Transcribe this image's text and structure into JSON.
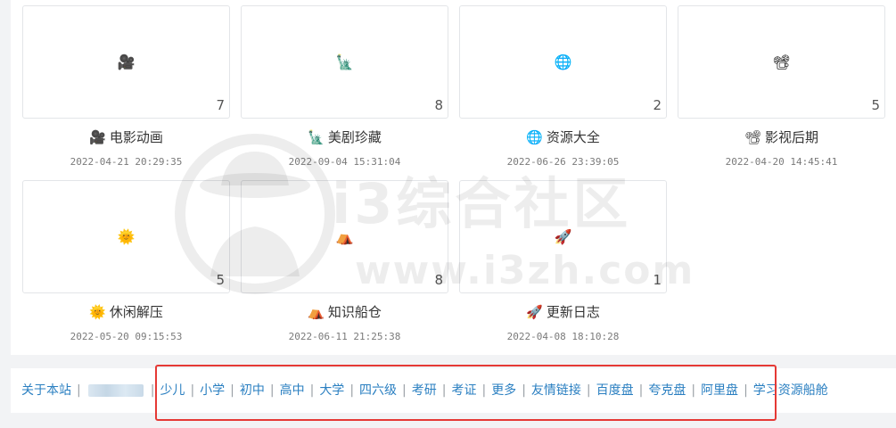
{
  "categories": [
    {
      "emoji": "🎥",
      "icon": "movie-camera-icon",
      "title": "电影动画",
      "count": "7",
      "date": "2022-04-21 20:29:35"
    },
    {
      "emoji": "🗽",
      "icon": "statue-of-liberty-icon",
      "title": "美剧珍藏",
      "count": "8",
      "date": "2022-09-04 15:31:04"
    },
    {
      "emoji": "🌐",
      "icon": "globe-icon",
      "title": "资源大全",
      "count": "2",
      "date": "2022-06-26 23:39:05"
    },
    {
      "emoji": "📽",
      "icon": "film-projector-icon",
      "title": "影视后期",
      "count": "5",
      "date": "2022-04-20 14:45:41"
    },
    {
      "emoji": "🌞",
      "icon": "sun-face-icon",
      "title": "休闲解压",
      "count": "5",
      "date": "2022-05-20 09:15:53"
    },
    {
      "emoji": "⛺",
      "icon": "tent-icon",
      "title": "知识船仓",
      "count": "8",
      "date": "2022-06-11 21:25:38"
    },
    {
      "emoji": "🚀",
      "icon": "rocket-icon",
      "title": "更新日志",
      "count": "1",
      "date": "2022-04-08 18:10:28"
    }
  ],
  "watermark": {
    "line1": "i3综合社区",
    "line2": "www.i3zh.com"
  },
  "footer": {
    "about": "关于本站",
    "links": [
      "少儿",
      "小学",
      "初中",
      "高中",
      "大学",
      "四六级",
      "考研",
      "考证",
      "更多",
      "友情链接",
      "百度盘",
      "夸克盘",
      "阿里盘"
    ],
    "last": "学习资源船舱"
  },
  "highlight_color": "#e53935",
  "link_color": "#2a7fc1"
}
